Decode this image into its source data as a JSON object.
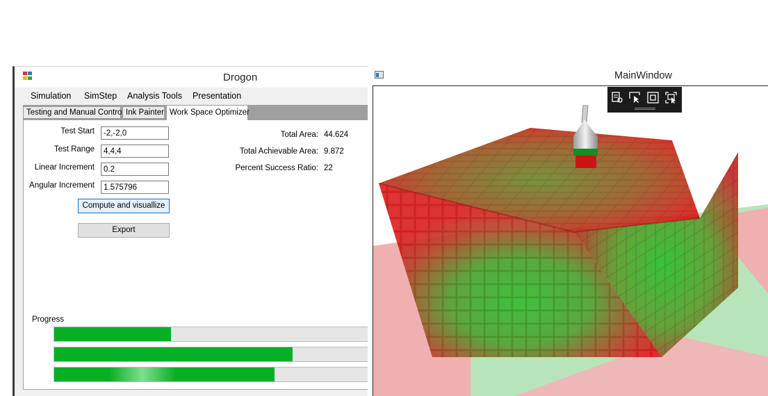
{
  "left_window": {
    "title": "Drogon",
    "menu": [
      "Simulation",
      "SimStep",
      "Analysis Tools",
      "Presentation"
    ],
    "tabs": [
      {
        "label": "Testing and Manual Control",
        "active": false
      },
      {
        "label": "Ink Painter",
        "active": false
      },
      {
        "label": "Work Space Optimizer",
        "active": true
      }
    ],
    "form": {
      "test_start": {
        "label": "Test Start",
        "value": "-2,-2,0"
      },
      "test_range": {
        "label": "Test Range",
        "value": "4,4,4"
      },
      "linear_increment": {
        "label": "Linear Increment",
        "value": "0.2"
      },
      "angular_increment": {
        "label": "Angular Increment",
        "value": "1.575796"
      }
    },
    "buttons": {
      "compute": "Compute and visuallize",
      "export": "Export"
    },
    "stats": {
      "total_area": {
        "label": "Total Area:",
        "value": "44.624"
      },
      "total_achievable_area": {
        "label": "Total Achievable Area:",
        "value": "9.872"
      },
      "percent_success_ratio": {
        "label": "Percent Success Ratio:",
        "value": "22"
      }
    },
    "progress": {
      "label": "Progress",
      "bars": [
        0.37,
        0.755,
        0.698
      ]
    }
  },
  "right_window": {
    "title": "MainWindow",
    "debug_toolbar_icons": [
      "select-element-icon",
      "hover-select-icon",
      "layout-adorner-icon",
      "track-focus-icon"
    ]
  },
  "colors": {
    "progress_green": "#06b025",
    "voxel_red": "#e01414",
    "voxel_green": "#1bb32a",
    "floor_red": "#eeaaaa",
    "floor_green": "#b5e4b8"
  }
}
